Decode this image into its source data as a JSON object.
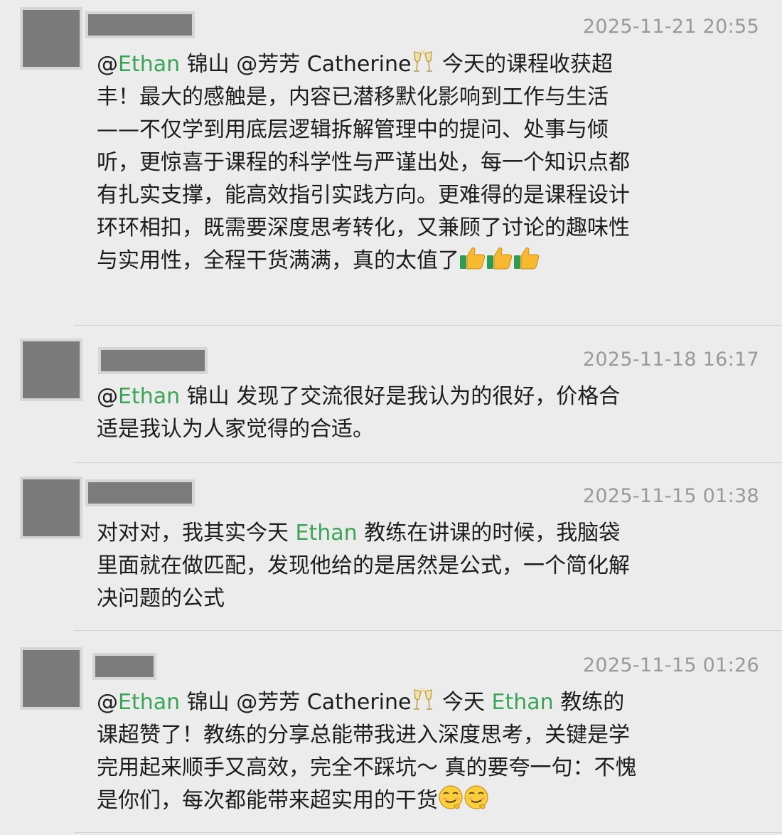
{
  "comments": [
    {
      "timestamp": "2025-11-21 20:55",
      "segments": [
        {
          "type": "text",
          "text": "@"
        },
        {
          "type": "mention",
          "text": "Ethan"
        },
        {
          "type": "text",
          "text": " 锦山 @芳芳 Catherine"
        },
        {
          "type": "emoji",
          "name": "clinking-glasses-icon"
        },
        {
          "type": "text",
          "text": " 今天的课程收获超丰！最大的感触是，内容已潜移默化影响到工作与生活——不仅学到用底层逻辑拆解管理中的提问、处事与倾听，更惊喜于课程的科学性与严谨出处，每一个知识点都有扎实支撑，能高效指引实践方向。更难得的是课程设计环环相扣，既需要深度思考转化，又兼顾了讨论的趣味性与实用性，全程干货满满，真的太值了"
        },
        {
          "type": "emoji",
          "name": "thumbs-up-icon"
        },
        {
          "type": "emoji",
          "name": "thumbs-up-icon"
        },
        {
          "type": "emoji",
          "name": "thumbs-up-icon"
        }
      ]
    },
    {
      "timestamp": "2025-11-18 16:17",
      "segments": [
        {
          "type": "text",
          "text": "@"
        },
        {
          "type": "mention",
          "text": "Ethan"
        },
        {
          "type": "text",
          "text": " 锦山 发现了交流很好是我认为的很好，价格合适是我认为人家觉得的合适。"
        }
      ]
    },
    {
      "timestamp": "2025-11-15 01:38",
      "segments": [
        {
          "type": "text",
          "text": "对对对，我其实今天 "
        },
        {
          "type": "mention",
          "text": "Ethan"
        },
        {
          "type": "text",
          "text": " 教练在讲课的时候，我脑袋里面就在做匹配，发现他给的是居然是公式，一个简化解决问题的公式"
        }
      ]
    },
    {
      "timestamp": "2025-11-15 01:26",
      "segments": [
        {
          "type": "text",
          "text": "@"
        },
        {
          "type": "mention",
          "text": "Ethan"
        },
        {
          "type": "text",
          "text": " 锦山 @芳芳 Catherine"
        },
        {
          "type": "emoji",
          "name": "clinking-glasses-icon"
        },
        {
          "type": "text",
          "text": " 今天 "
        },
        {
          "type": "mention",
          "text": "Ethan"
        },
        {
          "type": "text",
          "text": " 教练的课超赞了！教练的分享总能带我进入深度思考，关键是学完用起来顺手又高效，完全不踩坑～ 真的要夸一句：不愧是你们，每次都能带来超实用的干货"
        },
        {
          "type": "emoji",
          "name": "smug-face-icon"
        },
        {
          "type": "emoji",
          "name": "smug-face-icon"
        }
      ]
    }
  ],
  "colors": {
    "mention": "#3aa655",
    "timestamp": "#999999",
    "background": "#ececec"
  }
}
